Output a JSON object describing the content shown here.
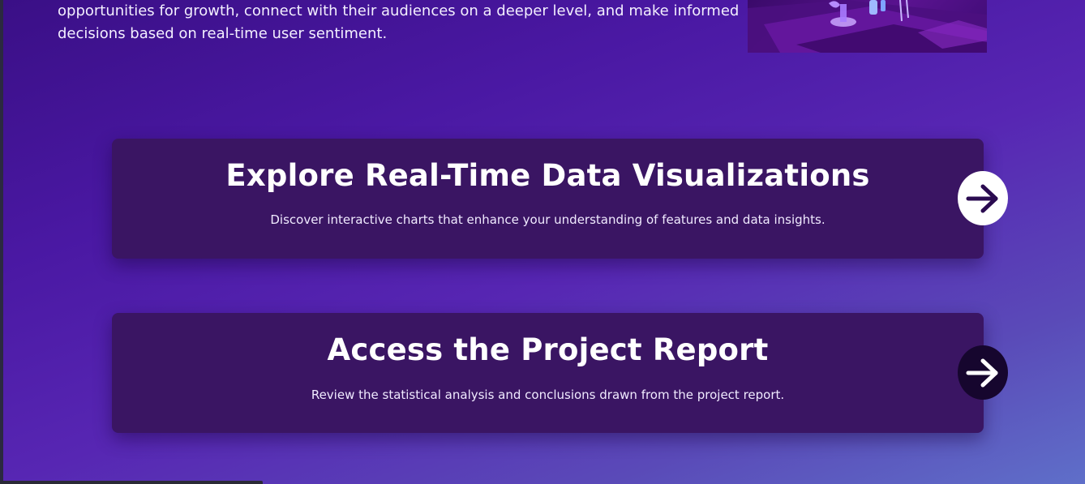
{
  "intro": {
    "lines": [
      "opportunities for growth, connect with their audiences on a deeper level, and make informed",
      "decisions based on real-time user sentiment."
    ]
  },
  "cards": [
    {
      "title": "Explore Real-Time Data Visualizations",
      "description": "Discover interactive charts that enhance your understanding of features and data insights.",
      "arrow_icon": "arrow-right-icon",
      "arrow_style": "light"
    },
    {
      "title": "Access the Project Report",
      "description": "Review the statistical analysis and conclusions drawn from the project report.",
      "arrow_icon": "arrow-right-icon",
      "arrow_style": "dark"
    }
  ],
  "colors": {
    "background_start": "#3a0f86",
    "background_end": "#5f6fc9",
    "card_background": "#3a1563",
    "arrow_light_bg": "#ffffff",
    "arrow_light_fg": "#2a0b50",
    "arrow_dark_bg": "#16062e",
    "arrow_dark_fg": "#ffffff"
  }
}
